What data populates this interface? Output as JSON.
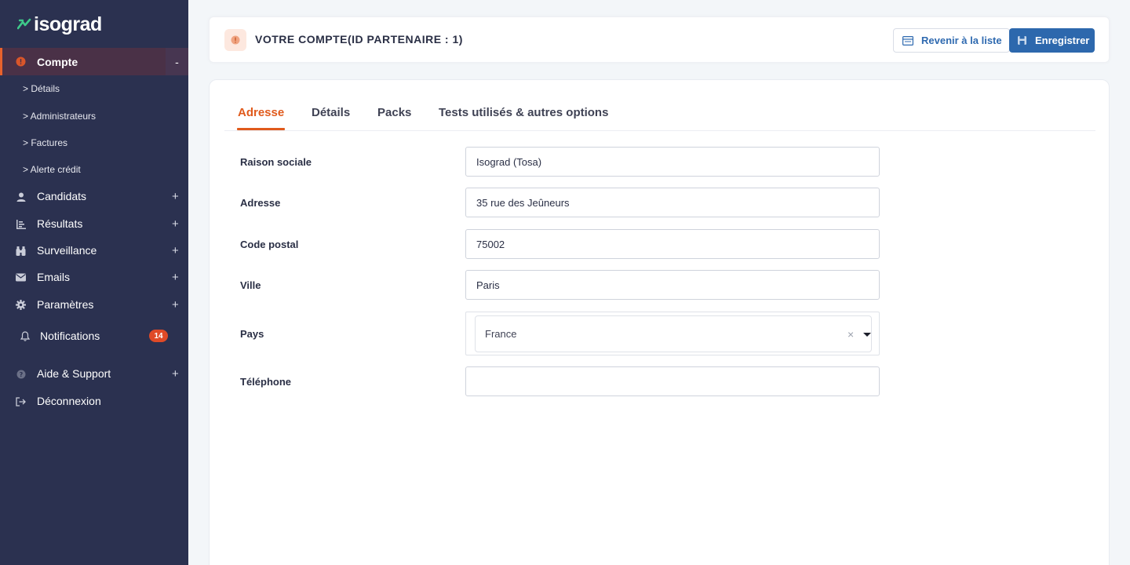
{
  "brand": {
    "name": "isograd",
    "accent": "#e8622c",
    "sidebar_bg": "#2b3150",
    "primary": "#2d68ad"
  },
  "sidebar": {
    "active": {
      "label": "Compte",
      "toggle": "-"
    },
    "subitems": [
      "> Détails",
      "> Administrateurs",
      "> Factures",
      "> Alerte crédit"
    ],
    "items": [
      {
        "label": "Candidats",
        "icon": "user-icon",
        "expand": "+"
      },
      {
        "label": "Résultats",
        "icon": "list-chart-icon",
        "expand": "+"
      },
      {
        "label": "Surveillance",
        "icon": "binoculars-icon",
        "expand": "+"
      },
      {
        "label": "Emails",
        "icon": "envelope-icon",
        "expand": "+"
      },
      {
        "label": "Paramètres",
        "icon": "gear-icon",
        "expand": "+"
      },
      {
        "label": "Notifications",
        "icon": "bell-icon",
        "badge": "14"
      },
      {
        "label": "Aide & Support",
        "icon": "question-icon",
        "expand": "+"
      },
      {
        "label": "Déconnexion",
        "icon": "logout-icon"
      }
    ]
  },
  "header": {
    "title": "VOTRE COMPTE(ID PARTENAIRE : 1)",
    "back_label": "Revenir à la liste",
    "save_label": "Enregistrer"
  },
  "tabs": [
    "Adresse",
    "Détails",
    "Packs",
    "Tests utilisés & autres options"
  ],
  "active_tab": "Adresse",
  "form": {
    "raison_sociale": {
      "label": "Raison sociale",
      "value": "Isograd (Tosa)"
    },
    "adresse": {
      "label": "Adresse",
      "value": "35 rue des Jeûneurs"
    },
    "code_postal": {
      "label": "Code postal",
      "value": "75002"
    },
    "ville": {
      "label": "Ville",
      "value": "Paris"
    },
    "pays": {
      "label": "Pays",
      "value": "France",
      "clear": "×"
    },
    "telephone": {
      "label": "Téléphone",
      "value": ""
    }
  }
}
